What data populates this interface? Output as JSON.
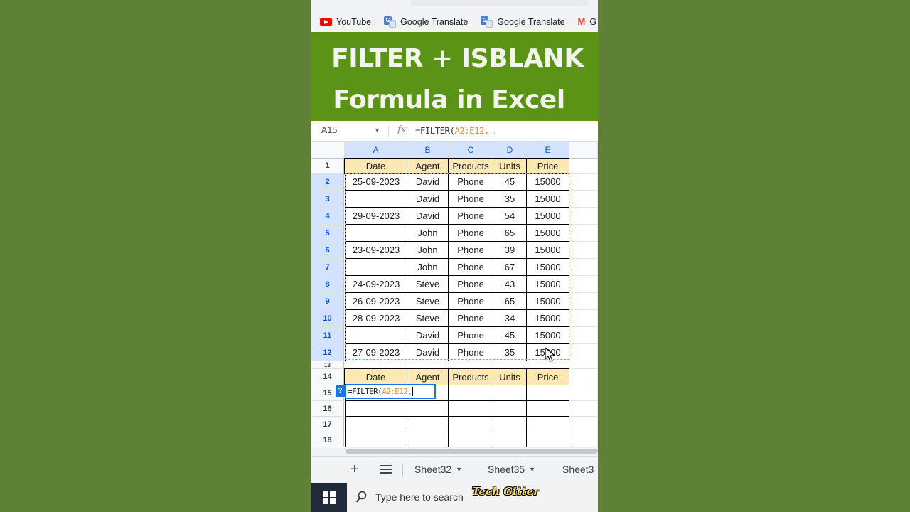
{
  "bookmarks": [
    "YouTube",
    "Google Translate",
    "Google Translate",
    "G"
  ],
  "banner": {
    "line1": "FILTER + ISBLANK",
    "line2": "Formula in Excel",
    "bg_color": "#5b9317"
  },
  "formula_bar": {
    "cell_ref": "A15",
    "fx": "fx",
    "formula_prefix": "=FILTER(",
    "formula_range": "A2:E12",
    "formula_suffix": ",",
    "hint_dots": ".."
  },
  "columns": [
    "A",
    "B",
    "C",
    "D",
    "E"
  ],
  "header_row": [
    "Date",
    "Agent",
    "Products",
    "Units",
    "Price"
  ],
  "rows": [
    [
      "25-09-2023",
      "David",
      "Phone",
      "45",
      "15000"
    ],
    [
      "",
      "David",
      "Phone",
      "35",
      "15000"
    ],
    [
      "29-09-2023",
      "David",
      "Phone",
      "54",
      "15000"
    ],
    [
      "",
      "John",
      "Phone",
      "65",
      "15000"
    ],
    [
      "23-09-2023",
      "John",
      "Phone",
      "39",
      "15000"
    ],
    [
      "",
      "John",
      "Phone",
      "67",
      "15000"
    ],
    [
      "24-09-2023",
      "Steve",
      "Phone",
      "43",
      "15000"
    ],
    [
      "26-09-2023",
      "Steve",
      "Phone",
      "65",
      "15000"
    ],
    [
      "28-09-2023",
      "Steve",
      "Phone",
      "34",
      "15000"
    ],
    [
      "",
      "David",
      "Phone",
      "45",
      "15000"
    ],
    [
      "27-09-2023",
      "David",
      "Phone",
      "35",
      "15000"
    ]
  ],
  "row_numbers": [
    "1",
    "2",
    "3",
    "4",
    "5",
    "6",
    "7",
    "8",
    "9",
    "10",
    "11",
    "12",
    "13",
    "14",
    "15",
    "16",
    "17",
    "18"
  ],
  "editor": {
    "prefix": "=FILTER(",
    "range": "A2:E12",
    "suffix": ",",
    "badge": "?"
  },
  "sheet_tabs": [
    "Sheet32",
    "Sheet35",
    "Sheet3"
  ],
  "taskbar": {
    "search_placeholder": "Type here to search",
    "watermark": "Tech Gitter"
  },
  "colors": {
    "page_background": "#5e8037",
    "header_fill": "#fce8b2",
    "range_highlight": "#e8913d",
    "selection_blue": "#1a73e8"
  }
}
